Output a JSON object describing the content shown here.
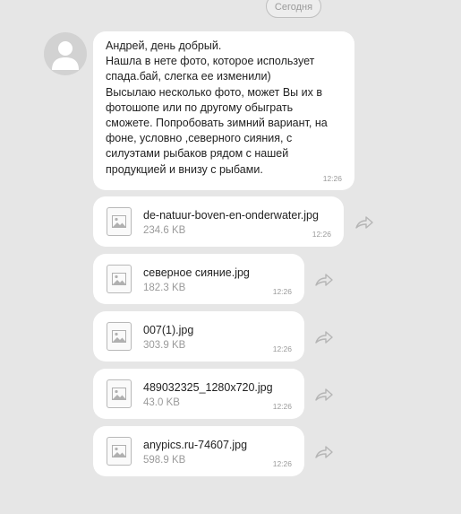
{
  "date_label": "Сегодня",
  "message": {
    "text": "Андрей, день добрый.\nНашла в нете фото, которое использует спада.бай, слегка ее изменили)\nВысылаю несколько фото, может Вы их в фотошопе или по другому обыграть сможете. Попробовать зимний вариант, на фоне, условно ,северного сияния, с силуэтами рыбаков рядом с нашей продукцией и внизу с рыбами.",
    "time": "12:26"
  },
  "files": [
    {
      "name": "de-natuur-boven-en-onderwater.jpg",
      "size": "234.6 KB",
      "time": "12:26"
    },
    {
      "name": "северное сияние.jpg",
      "size": "182.3 KB",
      "time": "12:26"
    },
    {
      "name": "007(1).jpg",
      "size": "303.9 KB",
      "time": "12:26"
    },
    {
      "name": "489032325_1280x720.jpg",
      "size": "43.0 KB",
      "time": "12:26"
    },
    {
      "name": "anypics.ru-74607.jpg",
      "size": "598.9 KB",
      "time": "12:26"
    }
  ],
  "icons": {
    "avatar": "user-avatar-placeholder",
    "file": "image-file-icon",
    "share": "share-arrow-icon"
  }
}
